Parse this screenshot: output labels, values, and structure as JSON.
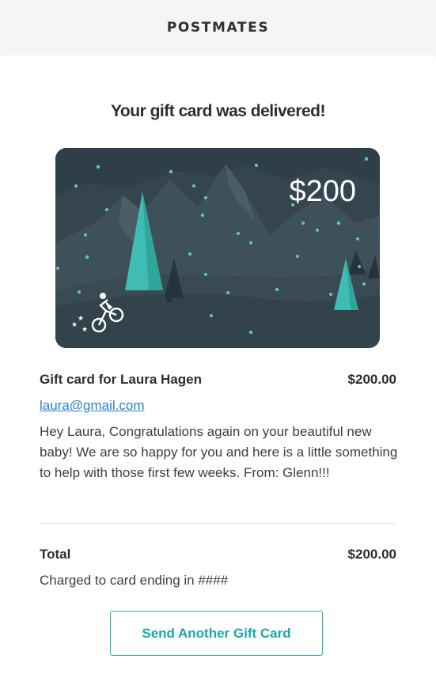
{
  "header": {
    "brand": "POSTMATES"
  },
  "main": {
    "title": "Your gift card was delivered!",
    "gift_card": {
      "amount": "$200"
    },
    "recipient": {
      "label": "Gift card for Laura Hagen",
      "amount": "$200.00",
      "email": "laura@gmail.com",
      "message": "Hey Laura, Congratulations again on your beautiful new baby! We are so happy for you and here is a little something to help with those first few weeks. From: Glenn!!!"
    },
    "total": {
      "label": "Total",
      "amount": "$200.00",
      "charged_text": "Charged to card ending in ####"
    },
    "cta_label": "Send Another Gift Card"
  },
  "colors": {
    "accent": "#24b3b0",
    "link": "#2e7fc8",
    "card_bg": "#2f3f49"
  }
}
